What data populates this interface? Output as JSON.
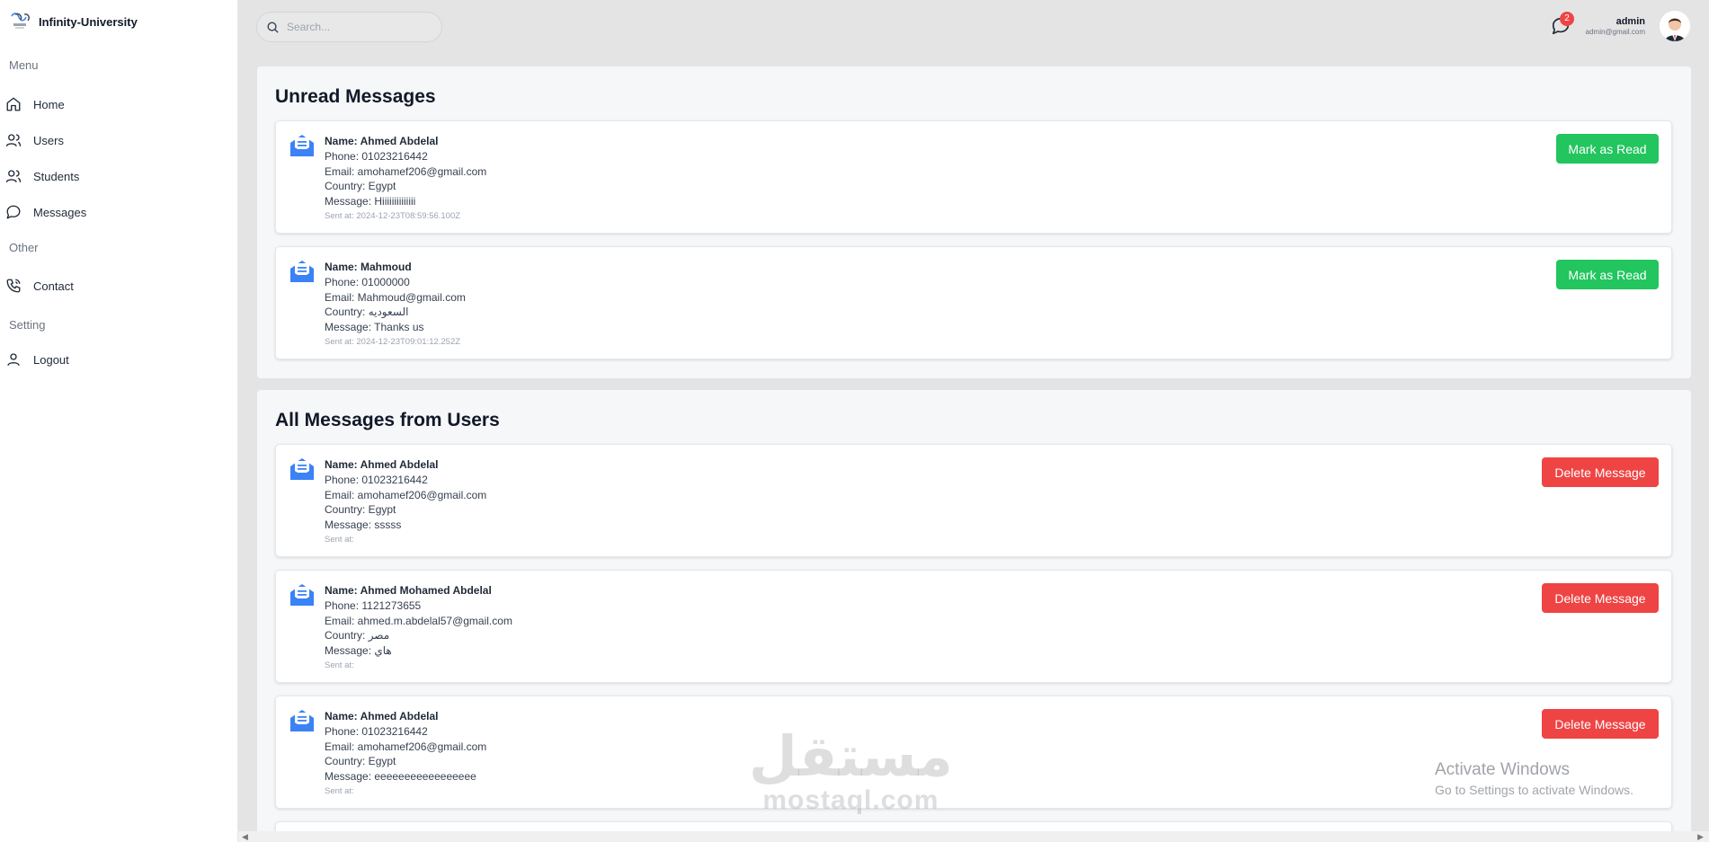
{
  "sidebar": {
    "brand": "Infinity-University",
    "sections": {
      "menu": "Menu",
      "other": "Other",
      "setting": "Setting"
    },
    "items": [
      {
        "label": "Home",
        "icon": "home-icon"
      },
      {
        "label": "Users",
        "icon": "users-icon"
      },
      {
        "label": "Students",
        "icon": "students-icon"
      },
      {
        "label": "Messages",
        "icon": "chat-bubble-icon"
      },
      {
        "label": "Contact",
        "icon": "phone-icon"
      },
      {
        "label": "Logout",
        "icon": "user-icon"
      }
    ]
  },
  "header": {
    "search_placeholder": "Search...",
    "notification_count": "2",
    "user_name": "admin",
    "user_email": "admin@gmail.com"
  },
  "unread": {
    "title": "Unread Messages",
    "button_label": "Mark as Read",
    "messages": [
      {
        "name": "Name: Ahmed Abdelal",
        "phone": "Phone: 01023216442",
        "email": "Email: amohamef206@gmail.com",
        "country": "Country: Egypt",
        "message": "Message: Hiiiiiiiiiiiiii",
        "sent": "Sent at: 2024-12-23T08:59:56.100Z"
      },
      {
        "name": "Name: Mahmoud",
        "phone": "Phone: 01000000",
        "email": "Email: Mahmoud@gmail.com",
        "country": "Country: السعوديه",
        "message": "Message: Thanks us",
        "sent": "Sent at: 2024-12-23T09:01:12.252Z"
      }
    ]
  },
  "all": {
    "title": "All Messages from Users",
    "button_label": "Delete Message",
    "messages": [
      {
        "name": "Name: Ahmed Abdelal",
        "phone": "Phone: 01023216442",
        "email": "Email: amohamef206@gmail.com",
        "country": "Country: Egypt",
        "message": "Message: sssss",
        "sent": "Sent at:"
      },
      {
        "name": "Name: Ahmed Mohamed Abdelal",
        "phone": "Phone: 1121273655",
        "email": "Email: ahmed.m.abdelal57@gmail.com",
        "country": "Country: مصر",
        "message": "Message: هاي",
        "sent": "Sent at:"
      },
      {
        "name": "Name: Ahmed Abdelal",
        "phone": "Phone: 01023216442",
        "email": "Email: amohamef206@gmail.com",
        "country": "Country: Egypt",
        "message": "Message: eeeeeeeeeeeeeeeee",
        "sent": "Sent at:"
      }
    ]
  },
  "watermarks": {
    "activate_title": "Activate Windows",
    "activate_sub": "Go to Settings to activate Windows.",
    "mostaql_ar": "مستقل",
    "mostaql_en": "mostaql.com"
  },
  "colors": {
    "mark_read": "#22c55e",
    "delete": "#ef4444",
    "icon_blue": "#3b82f6"
  }
}
